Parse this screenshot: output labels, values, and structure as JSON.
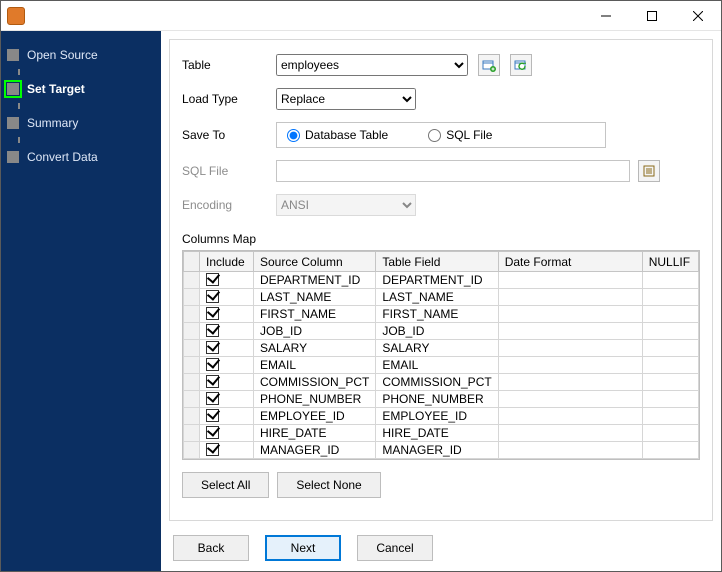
{
  "sidebar": {
    "steps": [
      {
        "label": "Open Source"
      },
      {
        "label": "Set Target"
      },
      {
        "label": "Summary"
      },
      {
        "label": "Convert Data"
      }
    ],
    "current_index": 1
  },
  "form": {
    "table_label": "Table",
    "table_value": "employees",
    "loadtype_label": "Load Type",
    "loadtype_value": "Replace",
    "saveto_label": "Save To",
    "saveto_options": {
      "db": "Database Table",
      "sql": "SQL File"
    },
    "saveto_selected": "db",
    "sqlfile_label": "SQL File",
    "sqlfile_value": "",
    "encoding_label": "Encoding",
    "encoding_value": "ANSI",
    "columns_map_label": "Columns Map",
    "headers": {
      "include": "Include",
      "source": "Source Column",
      "field": "Table Field",
      "dateformat": "Date Format",
      "nullif": "NULLIF"
    },
    "rows": [
      {
        "include": true,
        "source": "DEPARTMENT_ID",
        "field": "DEPARTMENT_ID",
        "dateformat": "",
        "nullif": ""
      },
      {
        "include": true,
        "source": "LAST_NAME",
        "field": "LAST_NAME",
        "dateformat": "",
        "nullif": ""
      },
      {
        "include": true,
        "source": "FIRST_NAME",
        "field": "FIRST_NAME",
        "dateformat": "",
        "nullif": ""
      },
      {
        "include": true,
        "source": "JOB_ID",
        "field": "JOB_ID",
        "dateformat": "",
        "nullif": ""
      },
      {
        "include": true,
        "source": "SALARY",
        "field": "SALARY",
        "dateformat": "",
        "nullif": ""
      },
      {
        "include": true,
        "source": "EMAIL",
        "field": "EMAIL",
        "dateformat": "",
        "nullif": ""
      },
      {
        "include": true,
        "source": "COMMISSION_PCT",
        "field": "COMMISSION_PCT",
        "dateformat": "",
        "nullif": ""
      },
      {
        "include": true,
        "source": "PHONE_NUMBER",
        "field": "PHONE_NUMBER",
        "dateformat": "",
        "nullif": ""
      },
      {
        "include": true,
        "source": "EMPLOYEE_ID",
        "field": "EMPLOYEE_ID",
        "dateformat": "",
        "nullif": ""
      },
      {
        "include": true,
        "source": "HIRE_DATE",
        "field": "HIRE_DATE",
        "dateformat": "",
        "nullif": ""
      },
      {
        "include": true,
        "source": "MANAGER_ID",
        "field": "MANAGER_ID",
        "dateformat": "",
        "nullif": ""
      }
    ],
    "select_all": "Select All",
    "select_none": "Select None"
  },
  "wizard": {
    "back": "Back",
    "next": "Next",
    "cancel": "Cancel"
  }
}
